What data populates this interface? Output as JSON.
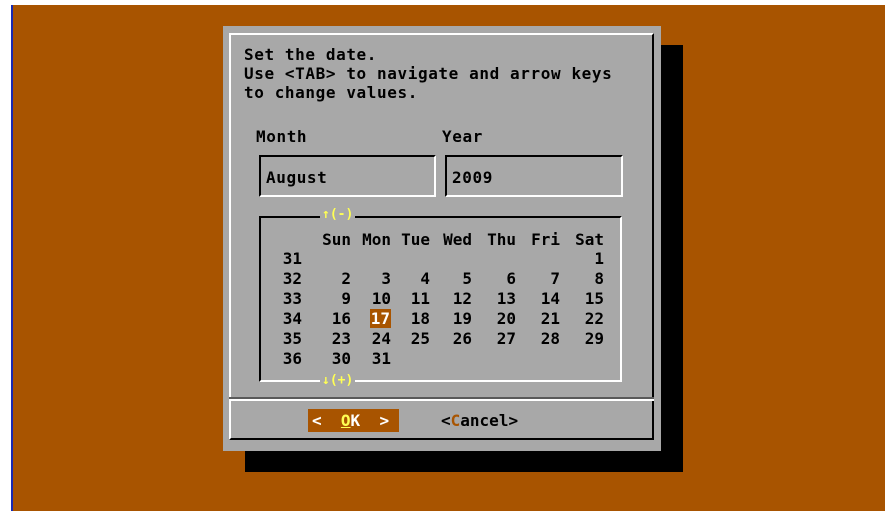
{
  "colors": {
    "desktop_bg": "#a85400",
    "dialog_bg": "#a8a8a8",
    "highlight_fg": "#ffff54",
    "selected_bg": "#a85400"
  },
  "dialog": {
    "prompt_lines": [
      "Set the date.",
      "Use <TAB> to navigate and arrow keys",
      "to change values."
    ],
    "month_label": "Month",
    "year_label": "Year",
    "month_value": "August",
    "year_value": "2009"
  },
  "calendar": {
    "scroll_up": "↑(-)",
    "scroll_down": "↓(+)",
    "day_headers": [
      "Sun",
      "Mon",
      "Tue",
      "Wed",
      "Thu",
      "Fri",
      "Sat"
    ],
    "selected_day": "17",
    "weeks": [
      {
        "week": "31",
        "days": [
          "",
          "",
          "",
          "",
          "",
          "",
          "1"
        ]
      },
      {
        "week": "32",
        "days": [
          "2",
          "3",
          "4",
          "5",
          "6",
          "7",
          "8"
        ]
      },
      {
        "week": "33",
        "days": [
          "9",
          "10",
          "11",
          "12",
          "13",
          "14",
          "15"
        ]
      },
      {
        "week": "34",
        "days": [
          "16",
          "17",
          "18",
          "19",
          "20",
          "21",
          "22"
        ]
      },
      {
        "week": "35",
        "days": [
          "23",
          "24",
          "25",
          "26",
          "27",
          "28",
          "29"
        ]
      },
      {
        "week": "36",
        "days": [
          "30",
          "31",
          "",
          "",
          "",
          "",
          ""
        ]
      }
    ]
  },
  "buttons": {
    "ok": {
      "left": "<",
      "hot": "O",
      "rest": "K",
      "right": ">"
    },
    "cancel": {
      "left": "<",
      "hot": "C",
      "rest": "ancel",
      "right": ">"
    }
  }
}
